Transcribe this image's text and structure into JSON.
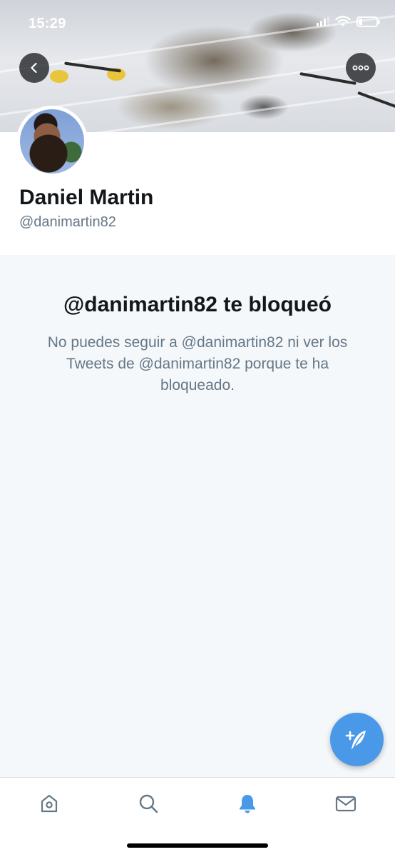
{
  "status_bar": {
    "time": "15:29"
  },
  "header": {
    "back_icon": "chevron-left-icon",
    "more_icon": "ellipsis-icon"
  },
  "profile": {
    "display_name": "Daniel Martin",
    "handle": "@danimartin82"
  },
  "blocked": {
    "title": "@danimartin82 te bloqueó",
    "description": "No puedes seguir a @danimartin82 ni ver los Tweets de @danimartin82 porque te ha bloqueado."
  },
  "fab": {
    "icon": "compose-tweet-icon"
  },
  "tabbar": {
    "tabs": [
      {
        "name": "home",
        "icon": "home-icon",
        "active": false
      },
      {
        "name": "search",
        "icon": "search-icon",
        "active": false
      },
      {
        "name": "notifications",
        "icon": "bell-icon",
        "active": true
      },
      {
        "name": "messages",
        "icon": "mail-icon",
        "active": false
      }
    ]
  },
  "colors": {
    "accent": "#4a99e9",
    "text_primary": "#14171a",
    "text_secondary": "#657786",
    "icon_inactive": "#657786",
    "background": "#f5f8fa"
  }
}
